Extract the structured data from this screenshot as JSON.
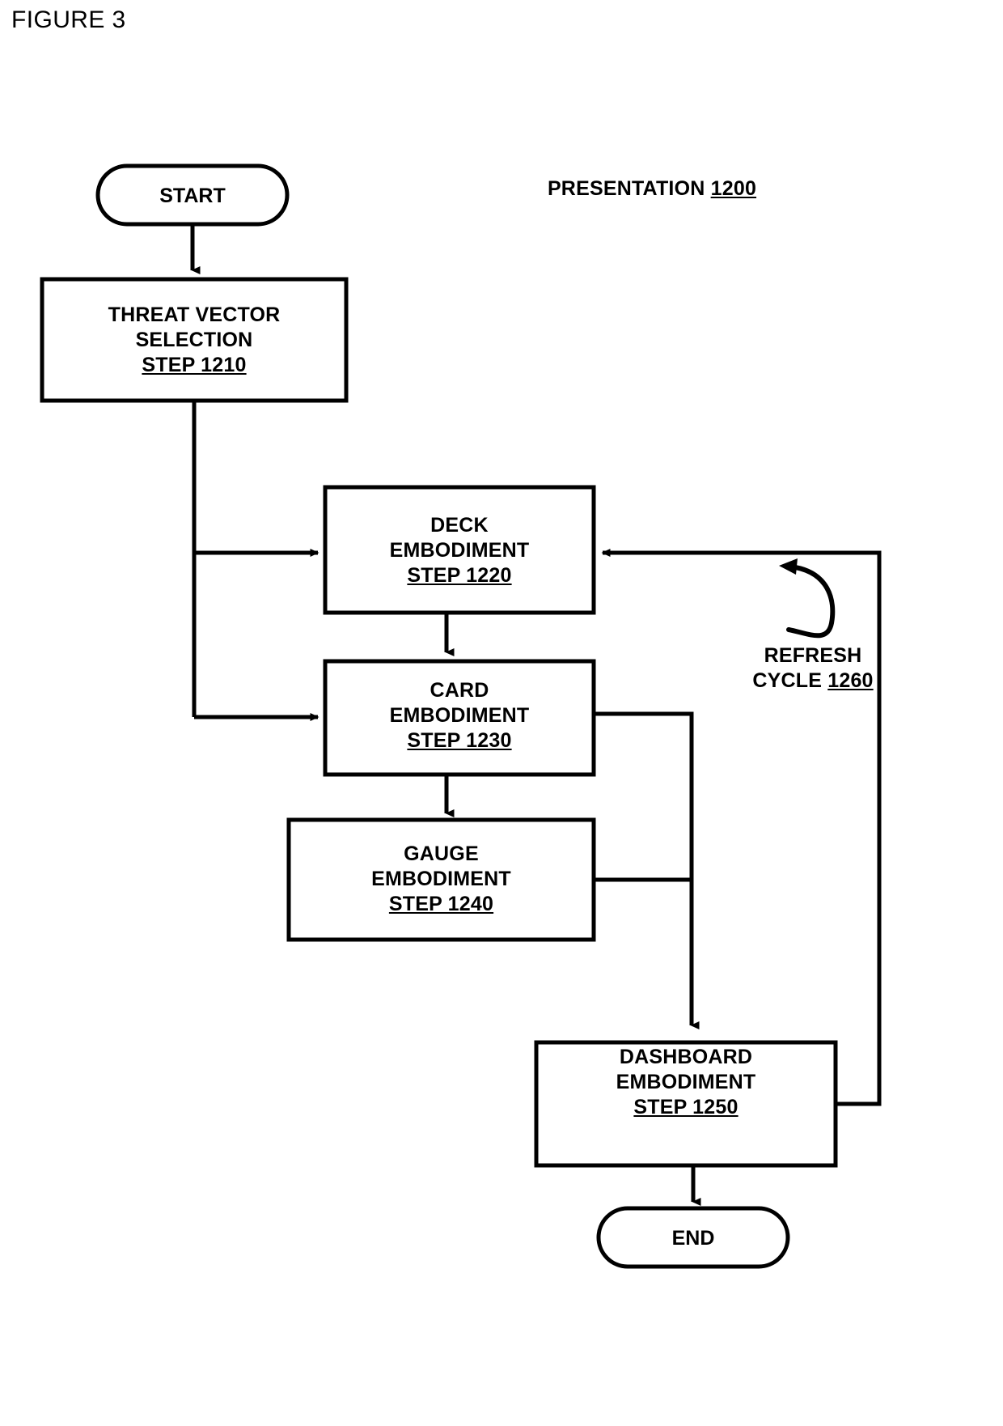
{
  "figure": {
    "title": "FIGURE 3"
  },
  "diagram_label": {
    "name": "PRESENTATION",
    "ref": "1200"
  },
  "terminators": [
    {
      "id": "start",
      "label": "START"
    },
    {
      "id": "end",
      "label": "END"
    }
  ],
  "nodes": [
    {
      "id": "threat-vector-selection",
      "line1": "THREAT VECTOR",
      "line2": "SELECTION",
      "step": "STEP 1210"
    },
    {
      "id": "deck-embodiment",
      "line1": "DECK",
      "line2": "EMBODIMENT",
      "step": "STEP 1220"
    },
    {
      "id": "card-embodiment",
      "line1": "CARD",
      "line2": "EMBODIMENT",
      "step": "STEP 1230"
    },
    {
      "id": "gauge-embodiment",
      "line1": "GAUGE",
      "line2": "EMBODIMENT",
      "step": "STEP 1240"
    },
    {
      "id": "dashboard-embodiment",
      "line1": "DASHBOARD",
      "line2": "EMBODIMENT",
      "step": "STEP 1250"
    }
  ],
  "annotations": [
    {
      "id": "refresh-cycle",
      "line1": "REFRESH",
      "line2": "CYCLE",
      "ref": "1260"
    }
  ],
  "colors": {
    "stroke": "#000000",
    "fill": "#ffffff",
    "text": "#000000"
  }
}
